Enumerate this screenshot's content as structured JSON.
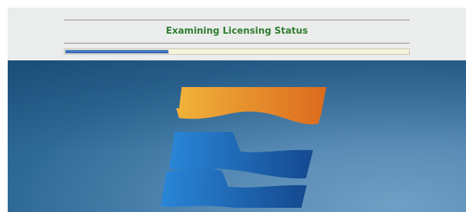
{
  "dialog": {
    "status_title": "Examining Licensing Status",
    "progress_fraction": 0.3
  },
  "splash": {
    "logo": "stacked-waves-logo-icon"
  },
  "colors": {
    "title_green": "#2f7d2f",
    "progress_blue": "#2c5fae",
    "logo_orange": "#e8a02a",
    "logo_blue": "#1d6fc4"
  }
}
